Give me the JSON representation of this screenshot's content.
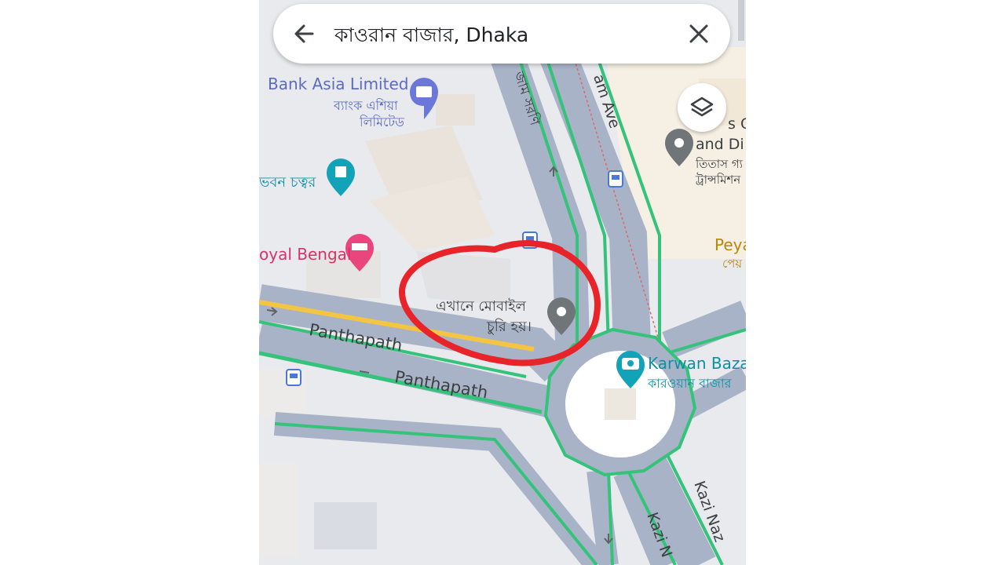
{
  "search": {
    "query": "কাওরান বাজার, Dhaka",
    "back_icon": "arrow-left-icon",
    "close_icon": "close-icon"
  },
  "map_controls": {
    "layers_icon": "layers-icon"
  },
  "places": [
    {
      "id": "bank-asia",
      "label_en": "Bank Asia Limited",
      "label_bn": "ব্যাংক এশিয়া লিমিটেড",
      "label_bn_line1": "ব্যাংক এশিয়া",
      "label_bn_line2": "লিমিটেড",
      "icon": "bank-marker-icon",
      "color": "#6b77d9"
    },
    {
      "id": "bhaban-chattar",
      "label_bn": "ভবন চত্বর",
      "icon": "landmark-marker-icon",
      "color": "#13a3b8"
    },
    {
      "id": "royal-bengal",
      "label_en": "oyal Bengal",
      "icon": "hotel-marker-icon",
      "color": "#e8467c"
    },
    {
      "id": "titas",
      "label_en_line1": "s G",
      "label_en_line2": "and Di",
      "label_bn_line1": "তিতাস গ্য",
      "label_bn_line2": "ট্রান্সমিশন",
      "icon": "place-marker-icon",
      "color": "#70757a"
    },
    {
      "id": "peya",
      "label_en": "Peya",
      "label_bn": "পেয়",
      "color": "#b8860b"
    },
    {
      "id": "karwan-bazar",
      "label_en": "Karwan Baza",
      "label_bn": "কারওয়ান বাজার",
      "icon": "camera-marker-icon",
      "color": "#13a3b8"
    },
    {
      "id": "annotation",
      "label_bn_line1": "এখানে মোবাইল",
      "label_bn_line2": "চুরি হয়।",
      "icon": "place-marker-icon",
      "color": "#70757a"
    }
  ],
  "roads": [
    {
      "label": "Panthapath"
    },
    {
      "label": "Panthapath"
    },
    {
      "label": "Kazi Naz"
    },
    {
      "label": "Kazi N"
    },
    {
      "label": "am Ave"
    },
    {
      "label": "জাম সরণি"
    }
  ],
  "colors": {
    "road": "#a9b3c7",
    "traffic_green": "#35c27a",
    "highlight_yellow": "#f4c542",
    "annotation_red": "#e8232a",
    "map_bg": "#e8eaed"
  }
}
